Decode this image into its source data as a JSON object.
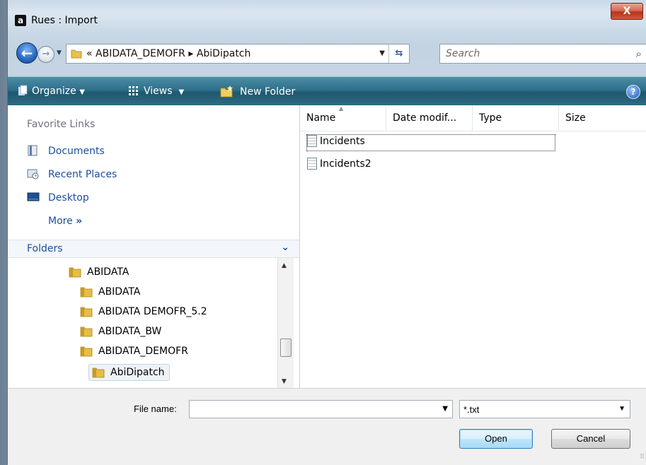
{
  "window": {
    "title": "Rues : Import",
    "app_icon_glyph": "a",
    "close_glyph": "X"
  },
  "nav": {
    "back_glyph": "←",
    "forward_glyph": "→",
    "address_crumbs": "« ABIDATA_DEMOFR ▸ AbiDipatch",
    "search_placeholder": "Search"
  },
  "toolbar": {
    "organize": "Organize",
    "views": "Views",
    "new_folder": "New Folder",
    "help_glyph": "?"
  },
  "sidebar": {
    "favorite_links_heading": "Favorite Links",
    "favorites": [
      {
        "label": "Documents",
        "icon": "documents-icon"
      },
      {
        "label": "Recent Places",
        "icon": "recent-places-icon"
      },
      {
        "label": "Desktop",
        "icon": "desktop-icon"
      }
    ],
    "more_label": "More",
    "more_glyph": "»",
    "folders_heading": "Folders",
    "folders_chevron": "⌄",
    "tree": [
      {
        "label": "ABIDATA"
      },
      {
        "label": "ABIDATA"
      },
      {
        "label": "ABIDATA DEMOFR_5.2"
      },
      {
        "label": "ABIDATA_BW"
      },
      {
        "label": "ABIDATA_DEMOFR"
      },
      {
        "label": "AbiDipatch"
      }
    ]
  },
  "filelist": {
    "columns": [
      "Name",
      "Date modif...",
      "Type",
      "Size"
    ],
    "files": [
      {
        "name": "Incidents"
      },
      {
        "name": "Incidents2"
      }
    ]
  },
  "footer": {
    "file_name_label": "File name:",
    "file_name_value": "",
    "filter_value": "*.txt",
    "open_label": "Open",
    "cancel_label": "Cancel"
  },
  "colors": {
    "toolbar": "#2e6f8a",
    "link": "#1e4fa0",
    "close": "#c8452a"
  }
}
